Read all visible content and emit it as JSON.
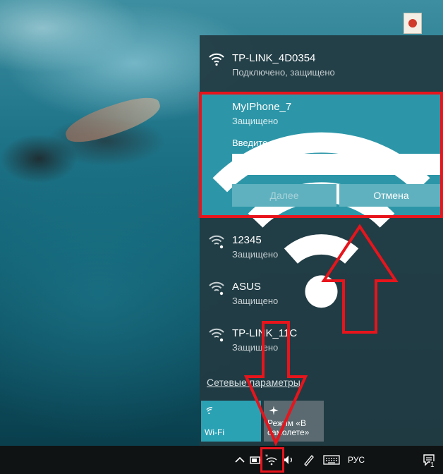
{
  "networks": [
    {
      "name": "TP-LINK_4D0354",
      "status": "Подключено, защищено"
    },
    {
      "name": "MyIPhone_7",
      "status": "Защищено"
    },
    {
      "name": "12345",
      "status": "Защищено"
    },
    {
      "name": "ASUS",
      "status": "Защищено"
    },
    {
      "name": "TP-LINK_11C",
      "status": "Защищено"
    }
  ],
  "connect_form": {
    "key_label": "Введите ключ безопасности сети",
    "key_value": "",
    "next_label": "Далее",
    "cancel_label": "Отмена"
  },
  "network_settings_link": "Сетевые параметры",
  "quick_actions": [
    {
      "label": "Wi-Fi",
      "icon": "wifi-icon",
      "active": true
    },
    {
      "label": "Режим «В самолете»",
      "icon": "airplane-icon",
      "active": false
    }
  ],
  "taskbar": {
    "language": "РУС",
    "notification_count": "1"
  },
  "colors": {
    "accent": "#2c96a8",
    "annotation": "#e8141c",
    "flyout_bg": "#223a42"
  }
}
